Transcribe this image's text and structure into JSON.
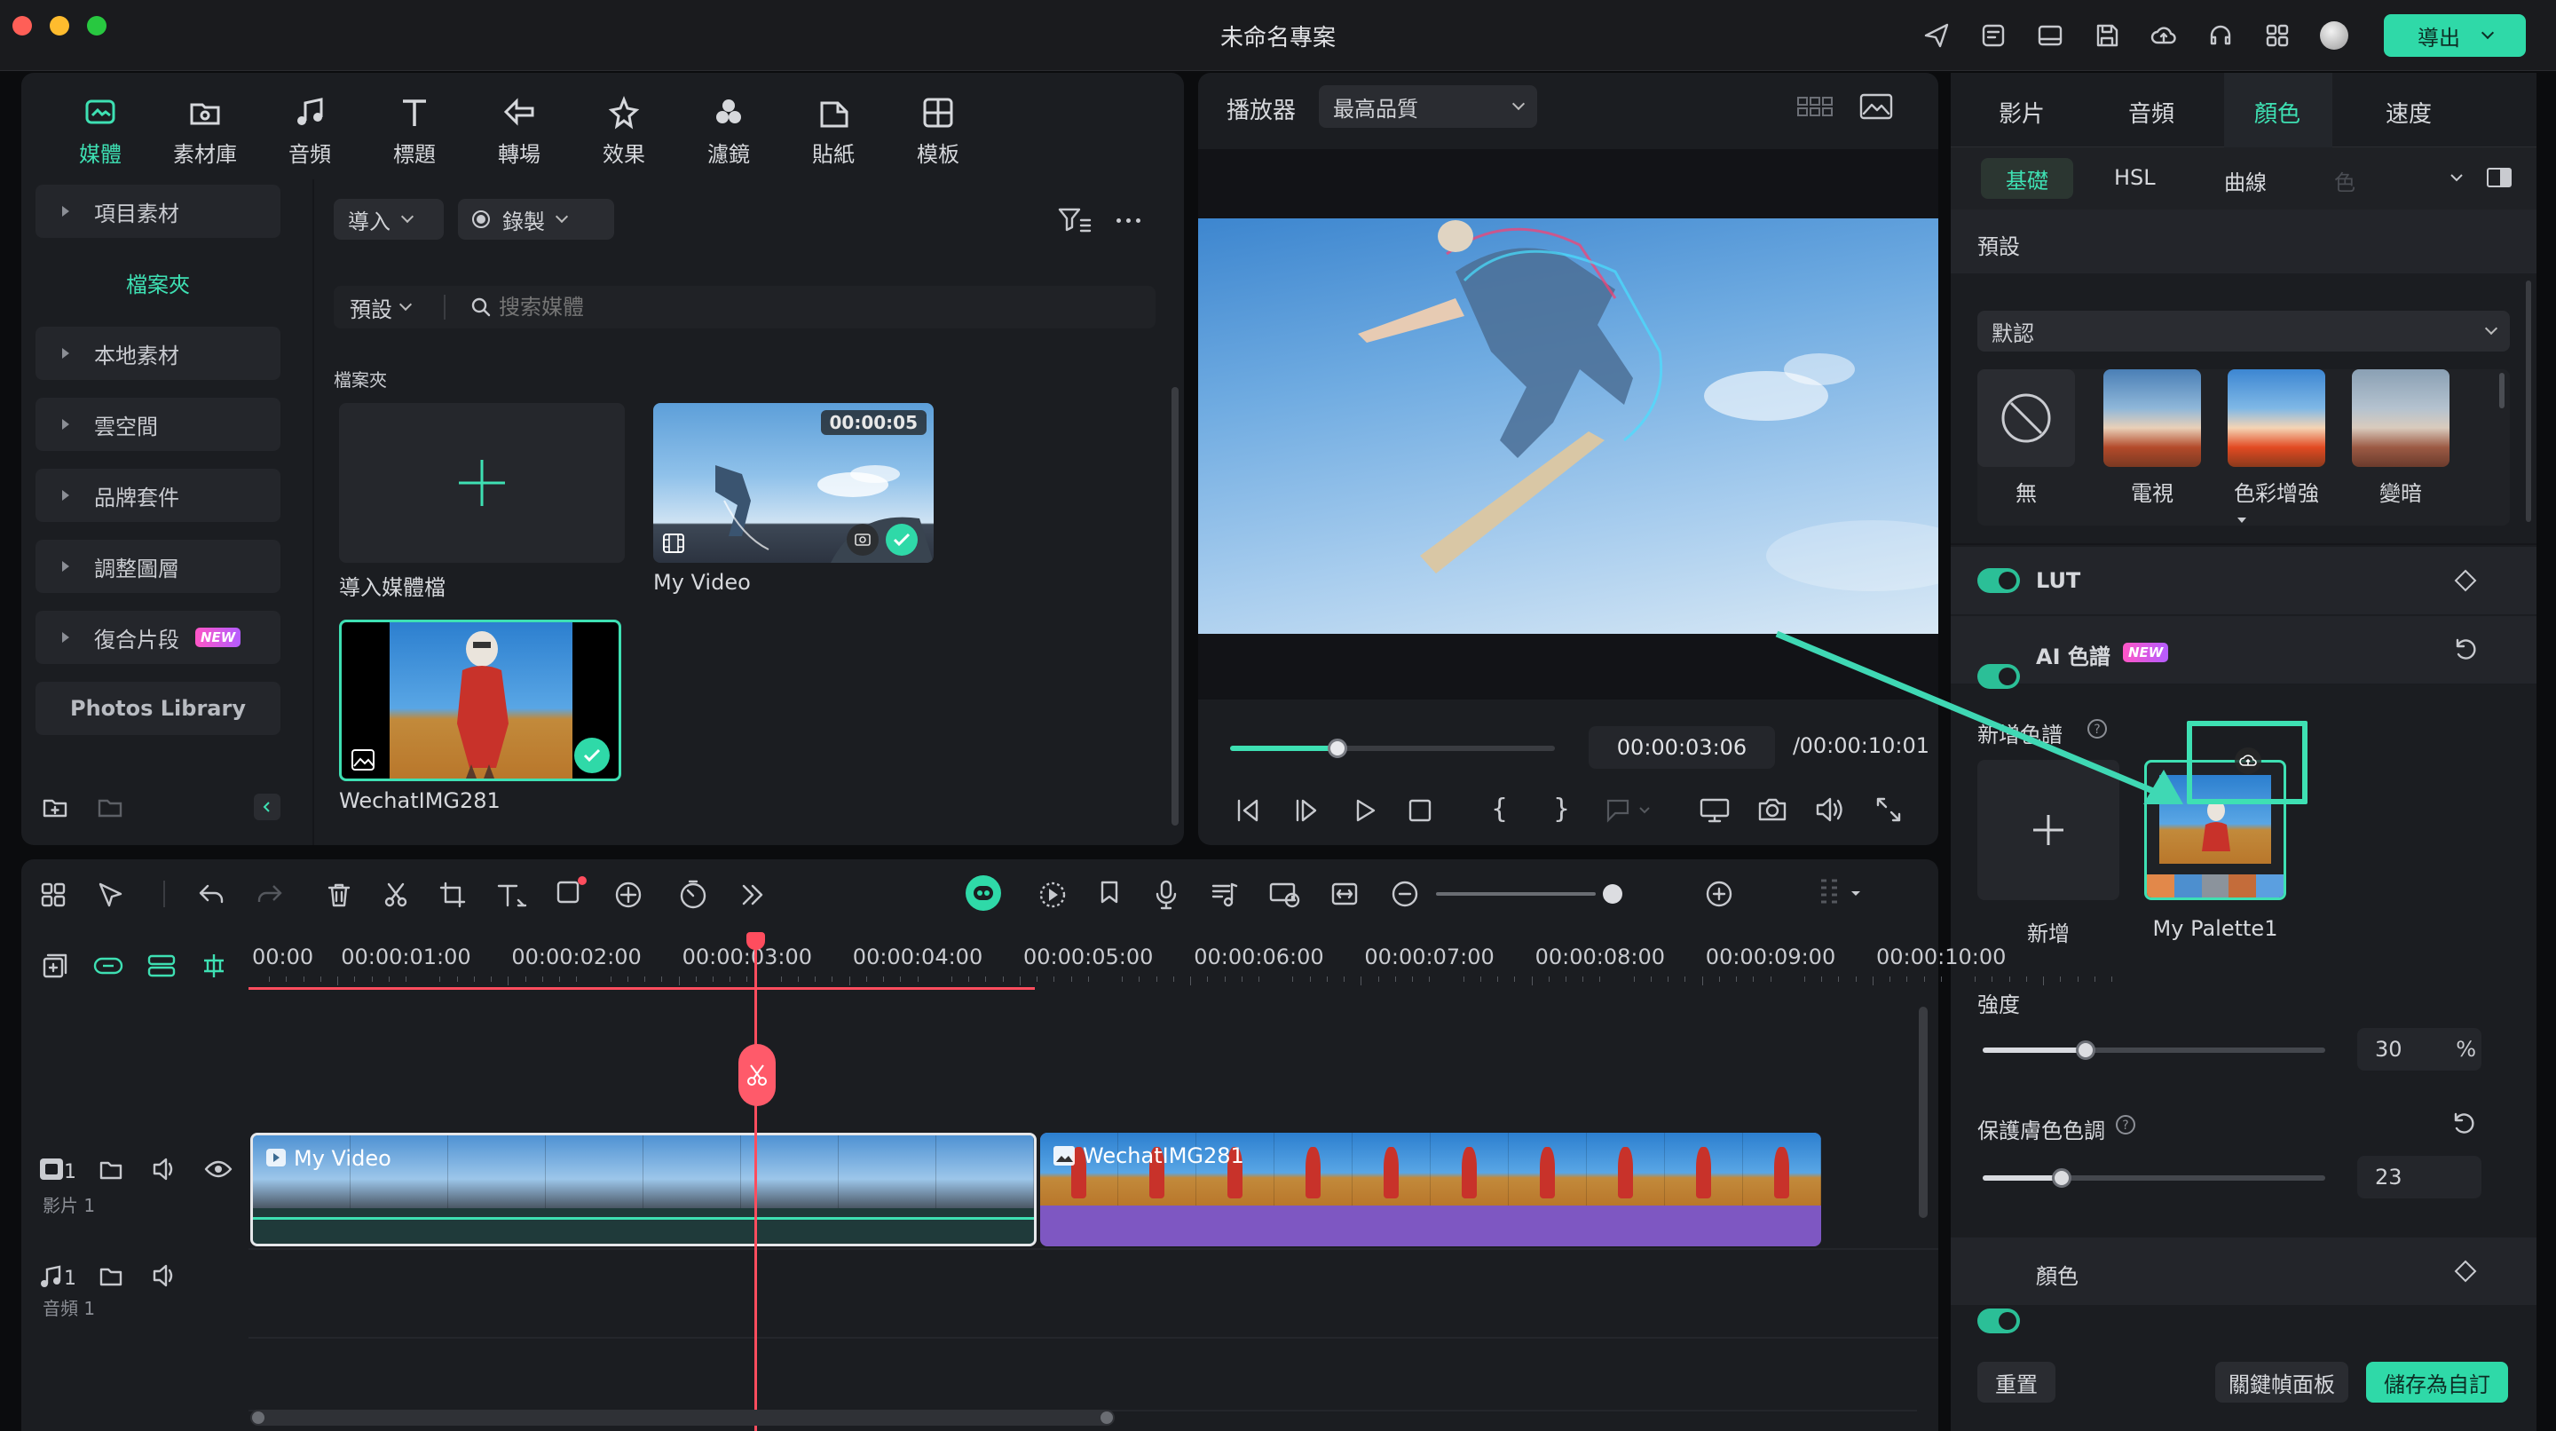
{
  "window": {
    "title": "未命名專案",
    "export_label": "導出"
  },
  "colors": {
    "accent": "#3ee0b3",
    "accent_dark": "#2bbf97",
    "playhead": "#ff4d5e",
    "purple_track": "#7e57c2",
    "panel": "#1b1d21"
  },
  "nav": {
    "items": [
      {
        "label": "媒體",
        "icon": "media-icon",
        "active": true
      },
      {
        "label": "素材庫",
        "icon": "stock-media-icon"
      },
      {
        "label": "音頻",
        "icon": "music-note-icon"
      },
      {
        "label": "標題",
        "icon": "text-t-icon"
      },
      {
        "label": "轉場",
        "icon": "transition-arrows-icon"
      },
      {
        "label": "效果",
        "icon": "effects-star-icon"
      },
      {
        "label": "濾鏡",
        "icon": "filter-circles-icon"
      },
      {
        "label": "貼紙",
        "icon": "sticker-icon"
      },
      {
        "label": "模板",
        "icon": "template-grid-icon"
      }
    ]
  },
  "sidebar": {
    "items": [
      "項目素材",
      "本地素材",
      "雲空間",
      "品牌套件",
      "調整圖層",
      "復合片段"
    ],
    "folder_label": "檔案夾",
    "photos_library": "Photos Library",
    "new_badge": "NEW"
  },
  "media": {
    "import_label": "導入",
    "record_label": "錄製",
    "sort_label": "預設",
    "search_placeholder": "搜索媒體",
    "folder_heading": "檔案夾",
    "import_tile_label": "導入媒體檔",
    "clips": [
      {
        "name": "My Video",
        "duration": "00:00:05"
      },
      {
        "name": "WechatIMG281"
      }
    ]
  },
  "player": {
    "label": "播放器",
    "quality": "最高品質",
    "current_time": "00:00:03:06",
    "separator": "/",
    "total_time": "00:00:10:01",
    "progress": 0.33
  },
  "timeline": {
    "ruler": [
      "00:00",
      "00:00:01:00",
      "00:00:02:00",
      "00:00:03:00",
      "00:00:04:00",
      "00:00:05:00",
      "00:00:06:00",
      "00:00:07:00",
      "00:00:08:00",
      "00:00:09:00",
      "00:00:10:00"
    ],
    "video_track_label": "影片 1",
    "audio_track_label": "音頻 1",
    "track_number": "1",
    "clips": [
      {
        "name": "My Video"
      },
      {
        "name": "WechatIMG281"
      }
    ]
  },
  "right_panel": {
    "tabs": [
      "影片",
      "音頻",
      "顏色",
      "速度"
    ],
    "active_tab": "顏色",
    "subtabs": [
      "基礎",
      "HSL",
      "曲線",
      "色"
    ],
    "preset_heading": "預設",
    "preset_dropdown": "默認",
    "presets": [
      "無",
      "電視",
      "色彩增強",
      "變暗"
    ],
    "lut_label": "LUT",
    "ai_palette_label": "AI 色譜",
    "new_badge": "NEW",
    "add_palette_heading": "新增色譜",
    "add_label": "新增",
    "palette_name": "My Palette1",
    "strength_label": "強度",
    "strength_value": "30",
    "strength_unit": "%",
    "strength_level": 0.3,
    "protect_skin_label": "保護膚色色調",
    "protect_skin_value": "23",
    "protect_skin_level": 0.23,
    "color_label": "顏色",
    "reset_button": "重置",
    "keyframe_button": "關鍵幀面板",
    "save_button": "儲存為自訂"
  }
}
